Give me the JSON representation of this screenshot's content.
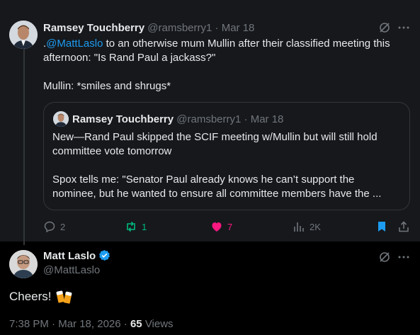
{
  "quoted_post": {
    "author_name": "Ramsey Touchberry",
    "author_handle": "@ramsberry1",
    "separator": "·",
    "date": "Mar 18",
    "mention": "@MattLaslo",
    "text_prefix": ".",
    "text_line1_rest": " to an otherwise mum Mullin after their classified meeting this",
    "text_line2": "afternoon: \"Is Rand Paul a jackass?\"",
    "text_line3": "Mullin: *smiles and shrugs*",
    "embedded": {
      "author_name": "Ramsey Touchberry",
      "author_handle": "@ramsberry1",
      "date": "Mar 18",
      "line1": "New—Rand Paul skipped the SCIF meeting w/Mullin but will still hold",
      "line2": "committee vote tomorrow",
      "line3": "Spox tells me: \"Senator Paul already knows he can’t support the",
      "line4": "nominee, but he wanted to ensure all committee members have the ..."
    },
    "actions": {
      "replies": "2",
      "reposts": "1",
      "likes": "7",
      "views": "2K"
    }
  },
  "reply_post": {
    "author_name": "Matt Laslo",
    "author_handle": "@MattLaslo",
    "text": "Cheers!",
    "emoji": "beer-mugs-emoji",
    "time": "7:38 PM",
    "separator": "·",
    "date": "Mar 18, 2026",
    "views_count": "65",
    "views_label": "Views"
  },
  "colors": {
    "background": "#000000",
    "card": "#16181c",
    "text": "#e7e9ea",
    "muted": "#71767b",
    "accent": "#1d9bf0",
    "repost_green": "#00ba7c",
    "like_pink": "#f91880",
    "verified": "#1d9bf0"
  },
  "icons": [
    "grok-icon",
    "more-icon",
    "reply-icon",
    "repost-icon",
    "like-icon",
    "views-icon",
    "bookmark-icon",
    "share-icon",
    "verified-icon"
  ]
}
